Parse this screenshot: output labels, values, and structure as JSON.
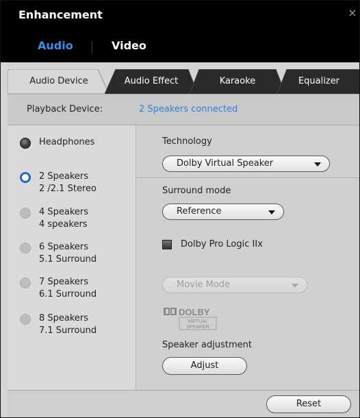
{
  "window": {
    "title": "Enhancement",
    "close_glyph": "×"
  },
  "topnav": {
    "audio": "Audio",
    "video": "Video"
  },
  "tabs": [
    "Audio Device",
    "Audio Effect",
    "Karaoke",
    "Equalizer"
  ],
  "playback": {
    "label": "Playback Device:",
    "value": "2 Speakers connected"
  },
  "devices": [
    {
      "line1": "Headphones",
      "line2": "",
      "state": "available"
    },
    {
      "line1": "2 Speakers",
      "line2": "2 /2.1 Stereo",
      "state": "selected"
    },
    {
      "line1": "4 Speakers",
      "line2": "4 speakers",
      "state": "unavailable"
    },
    {
      "line1": "6 Speakers",
      "line2": "5.1 Surround",
      "state": "unavailable"
    },
    {
      "line1": "7 Speakers",
      "line2": "6.1 Surround",
      "state": "unavailable"
    },
    {
      "line1": "8 Speakers",
      "line2": "7.1 Surround",
      "state": "unavailable"
    }
  ],
  "technology": {
    "label": "Technology",
    "value": "Dolby Virtual Speaker"
  },
  "surround": {
    "label": "Surround mode",
    "value": "Reference"
  },
  "prologic": {
    "label": "Dolby Pro Logic IIx",
    "checked": false
  },
  "movie_mode": {
    "value": "Movie Mode",
    "disabled": true
  },
  "dolby_logo": {
    "brand": "DOLBY",
    "line1": "VIRTUAL",
    "line2": "SPEAKER"
  },
  "speaker_adjustment": {
    "label": "Speaker adjustment",
    "button": "Adjust"
  },
  "footer": {
    "reset": "Reset"
  },
  "colors": {
    "accent": "#3a8de5",
    "link": "#3080d8",
    "title_bg": "#000000",
    "tab_dark": "#2a2a2a"
  }
}
